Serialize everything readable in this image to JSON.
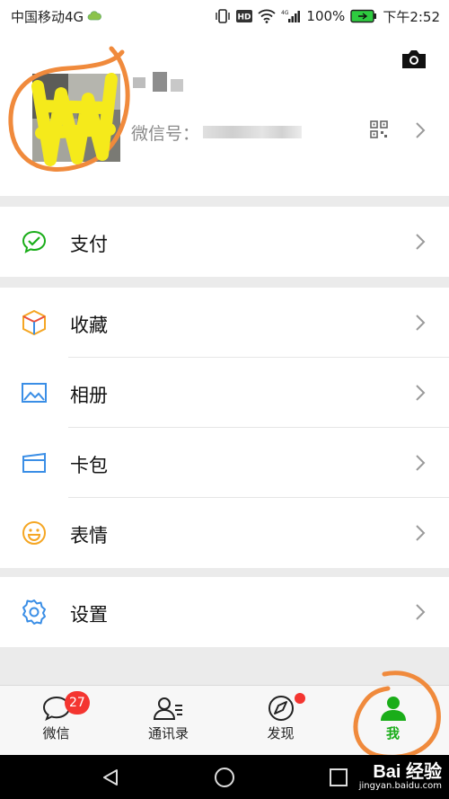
{
  "status_bar": {
    "carrier": "中国移动4G",
    "battery": "100%",
    "time": "下午2:52"
  },
  "profile": {
    "wechat_id_label": "微信号："
  },
  "menu": {
    "pay": "支付",
    "favorites": "收藏",
    "album": "相册",
    "cards": "卡包",
    "stickers": "表情",
    "settings": "设置"
  },
  "tabbar": {
    "tabs": [
      {
        "label": "微信",
        "badge": "27",
        "icon": "chat-bubble-icon"
      },
      {
        "label": "通讯录",
        "icon": "contacts-icon"
      },
      {
        "label": "发现",
        "icon": "compass-icon"
      },
      {
        "label": "我",
        "icon": "person-icon",
        "active": true
      }
    ]
  },
  "watermark": {
    "main": "Bai 经验",
    "sub": "jingyan.baidu.com"
  },
  "colors": {
    "accent_green": "#1aad19",
    "badge_red": "#f43530",
    "annotation_orange": "#f08a3c"
  }
}
